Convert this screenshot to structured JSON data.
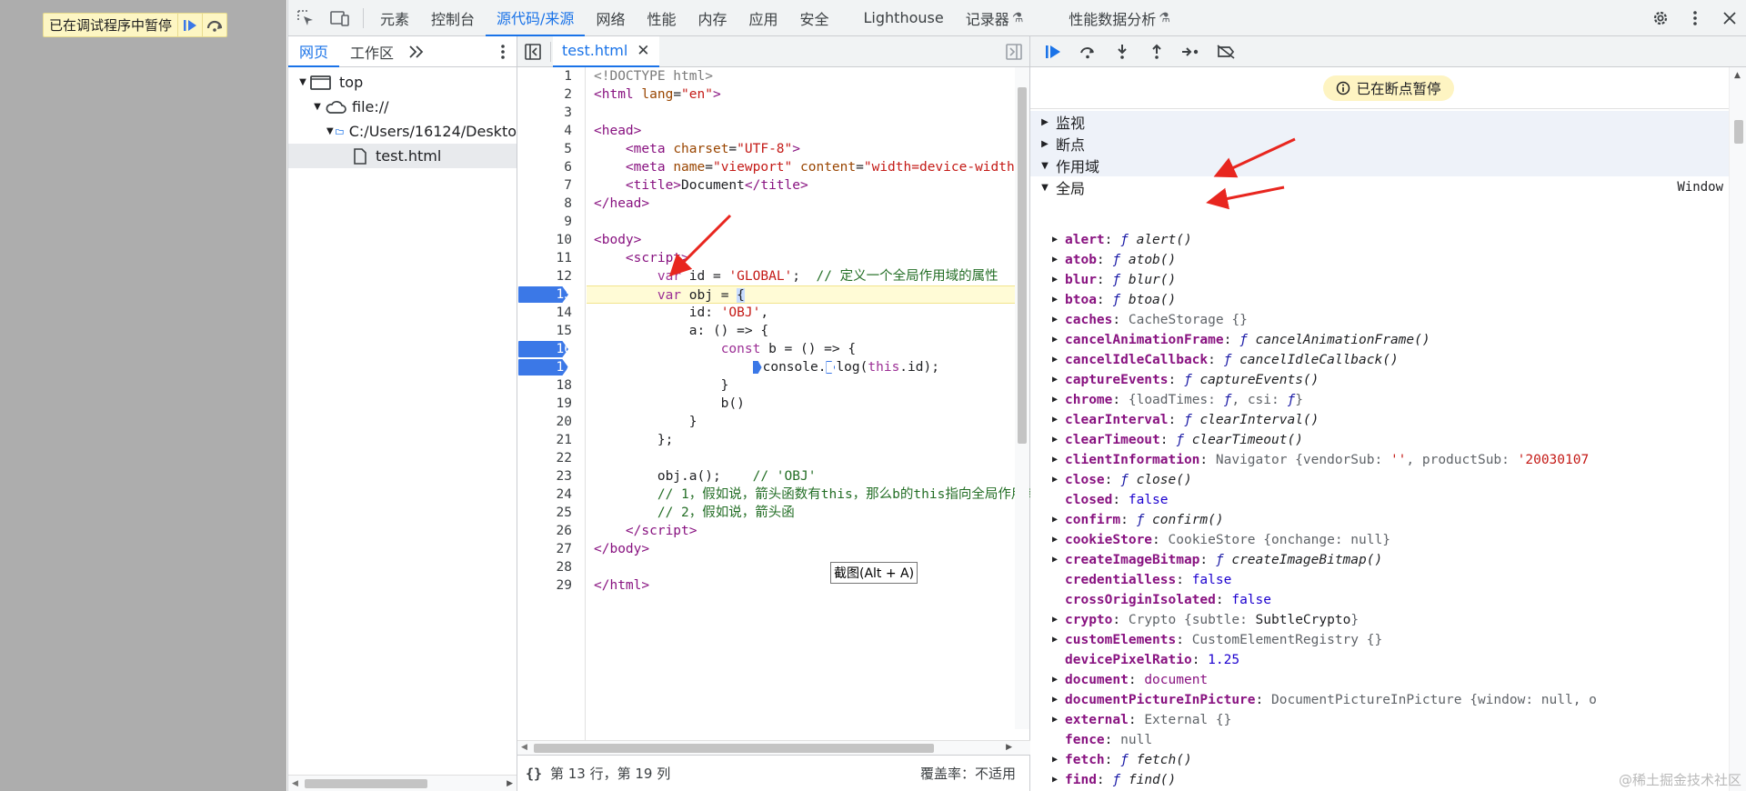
{
  "page": {
    "banner_text": "已在调试程序中暂停",
    "resume_icon": "resume-icon",
    "step_over_icon": "step-over-icon"
  },
  "topbar": {
    "tabs": [
      "元素",
      "控制台",
      "源代码/来源",
      "网络",
      "性能",
      "内存",
      "应用",
      "安全",
      "Lighthouse",
      "记录器",
      "性能数据分析"
    ],
    "active_tab": "源代码/来源"
  },
  "navigator": {
    "tabs": [
      "网页",
      "工作区"
    ],
    "tree": [
      "top",
      "file://",
      "C:/Users/16124/Deskto",
      "test.html"
    ]
  },
  "editor": {
    "tab_label": "test.html",
    "line_numbers": [
      "1",
      "2",
      "3",
      "4",
      "5",
      "6",
      "7",
      "8",
      "9",
      "10",
      "11",
      "12",
      "13",
      "14",
      "15",
      "16",
      "17",
      "18",
      "19",
      "20",
      "21",
      "22",
      "23",
      "24",
      "25",
      "26",
      "27",
      "28",
      "29"
    ],
    "breakpoint_lines": [
      "13",
      "16",
      "17"
    ],
    "tooltip": "截图(Alt + A)",
    "status_position": "第 13 行，第 19 列",
    "status_coverage": "覆盖率：不适用"
  },
  "debugger": {
    "paused_message": "已在断点暂停",
    "sections": [
      "监视",
      "断点",
      "作用域"
    ],
    "scope_global_label": "全局",
    "scope_global_value": "Window",
    "watermark": "@稀土掘金技术社区"
  },
  "colors": {
    "accent": "#1a73e8",
    "breakpoint": "#3b78e7",
    "exec_line": "#fffbd6",
    "arrow": "#e8261f"
  }
}
